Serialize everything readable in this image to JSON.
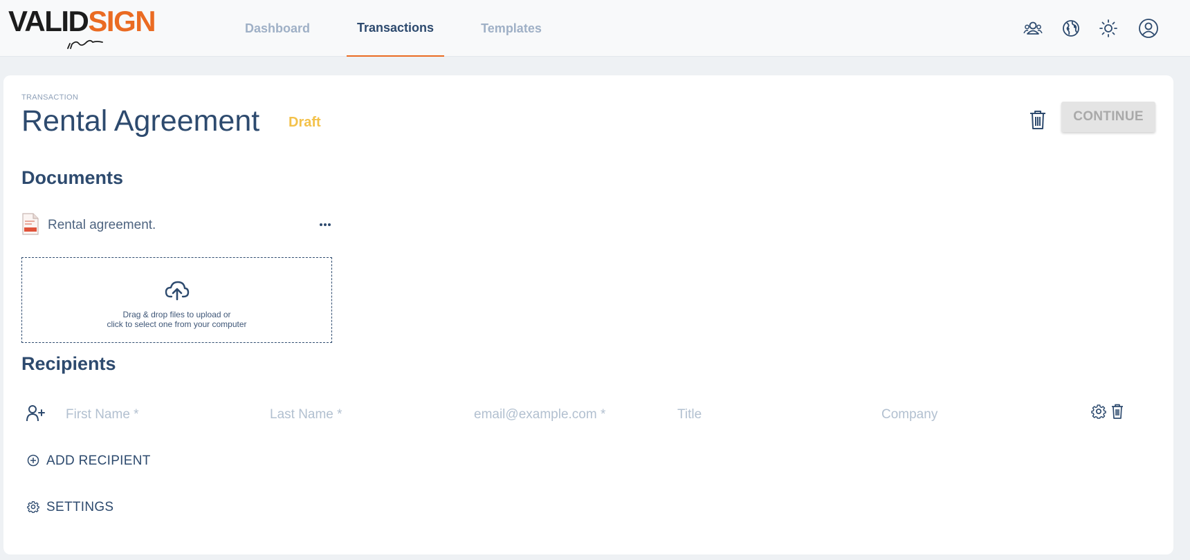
{
  "brand": {
    "logo_part1": "VALID",
    "logo_part2": "SIGN",
    "accent_color": "#ea6b22"
  },
  "nav": {
    "tabs": [
      {
        "label": "Dashboard",
        "active": false
      },
      {
        "label": "Transactions",
        "active": true
      },
      {
        "label": "Templates",
        "active": false
      }
    ]
  },
  "top_icons": [
    "team-icon",
    "globe-icon",
    "sun-icon",
    "user-account-icon"
  ],
  "transaction": {
    "eyebrow": "TRANSACTION",
    "title": "Rental Agreement",
    "status": "Draft",
    "status_color": "#f3c14a"
  },
  "actions": {
    "continue_label": "CONTINUE",
    "continue_disabled": true
  },
  "documents": {
    "heading": "Documents",
    "items": [
      {
        "name": "Rental agreement.",
        "type": "pdf"
      }
    ],
    "dropzone": {
      "line1": "Drag & drop files to upload or",
      "line2": "click to select one from your computer"
    }
  },
  "recipients": {
    "heading": "Recipients",
    "fields": {
      "first_name_placeholder": "First Name *",
      "last_name_placeholder": "Last Name *",
      "email_placeholder": "email@example.com *",
      "title_placeholder": "Title",
      "company_placeholder": "Company"
    },
    "add_label": "ADD RECIPIENT"
  },
  "settings": {
    "label": "SETTINGS"
  }
}
